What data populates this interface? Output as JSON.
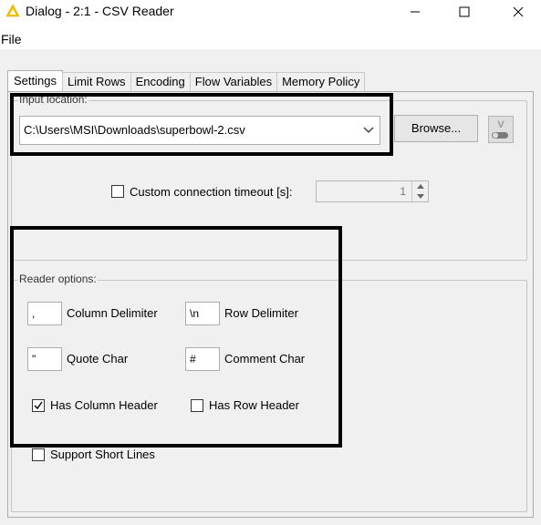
{
  "window": {
    "title": "Dialog - 2:1 - CSV Reader",
    "minimize_glyph": "—",
    "maximize_glyph": "☐",
    "close_glyph": "✕"
  },
  "menu": {
    "file": "File"
  },
  "tabs": [
    {
      "label": "Settings",
      "active": true
    },
    {
      "label": "Limit Rows"
    },
    {
      "label": "Encoding"
    },
    {
      "label": "Flow Variables"
    },
    {
      "label": "Memory Policy"
    }
  ],
  "input_location": {
    "legend": "Input location:",
    "path": "C:\\Users\\MSI\\Downloads\\superbowl-2.csv",
    "browse_label": "Browse...",
    "timeout_label": "Custom connection timeout [s]:",
    "timeout_checked": false,
    "timeout_value": "1"
  },
  "reader_options": {
    "legend": "Reader options:",
    "column_delimiter": {
      "value": ",",
      "label": "Column Delimiter"
    },
    "row_delimiter": {
      "value": "\\n",
      "label": "Row Delimiter"
    },
    "quote_char": {
      "value": "\"",
      "label": "Quote Char"
    },
    "comment_char": {
      "value": "#",
      "label": "Comment Char"
    },
    "has_column_header": {
      "label": "Has Column Header",
      "checked": true
    },
    "has_row_header": {
      "label": "Has Row Header",
      "checked": false
    },
    "support_short_lines": {
      "label": "Support Short Lines",
      "checked": false
    }
  },
  "colors": {
    "accent_icon": "#f2c200",
    "panel_bg": "#f0f0f0",
    "highlight": "#000000"
  }
}
